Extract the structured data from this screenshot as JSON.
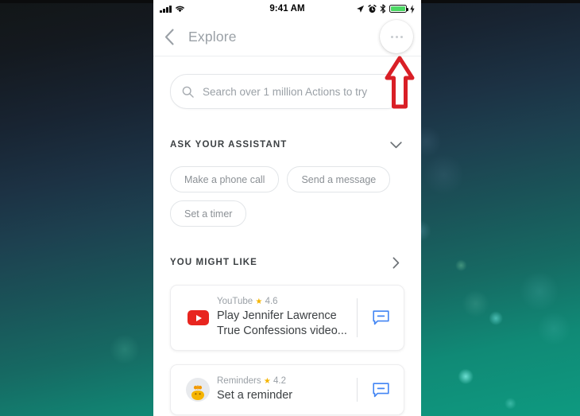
{
  "status_bar": {
    "time": "9:41 AM",
    "icons_left": [
      "signal-bars-icon",
      "wifi-icon"
    ],
    "icons_right": [
      "location-arrow-icon",
      "alarm-clock-icon",
      "bluetooth-icon",
      "battery-icon",
      "charging-bolt-icon"
    ],
    "battery_color": "#4cd964"
  },
  "header": {
    "back_icon": "chevron-left-icon",
    "title": "Explore",
    "more_icon": "more-options-icon"
  },
  "search": {
    "icon": "search-icon",
    "placeholder": "Search over 1 million Actions to try",
    "value": ""
  },
  "sections": [
    {
      "title": "ASK YOUR ASSISTANT",
      "chevron": "chevron-down-icon",
      "chips": [
        {
          "label": "Make a phone call"
        },
        {
          "label": "Send a message"
        },
        {
          "label": "Set a timer"
        }
      ]
    },
    {
      "title": "YOU MIGHT LIKE",
      "chevron": "chevron-right-icon"
    }
  ],
  "cards": [
    {
      "app": "YouTube",
      "rating": "4.6",
      "star": "★",
      "separator": "•",
      "title_line1": "Play Jennifer Lawrence",
      "title_line2": "True Confessions video...",
      "icon": "youtube-icon",
      "action_icon": "message-bubble-icon",
      "brand_color": "#e8251f",
      "action_color": "#4285f4"
    },
    {
      "app": "Reminders",
      "rating": "4.2",
      "star": "★",
      "separator": "•",
      "title_line1": "Set a reminder",
      "title_line2": "",
      "icon": "reminders-avatar-icon",
      "action_icon": "message-bubble-icon",
      "action_color": "#4285f4"
    }
  ],
  "annotation": {
    "arrow": "red-up-arrow-annotation",
    "color": "#d91f26",
    "points_at": "more-options-icon"
  },
  "wallpaper": {
    "top_color": "#121617",
    "mid_color": "#1d4150",
    "bottom_color": "#0e9a80"
  }
}
